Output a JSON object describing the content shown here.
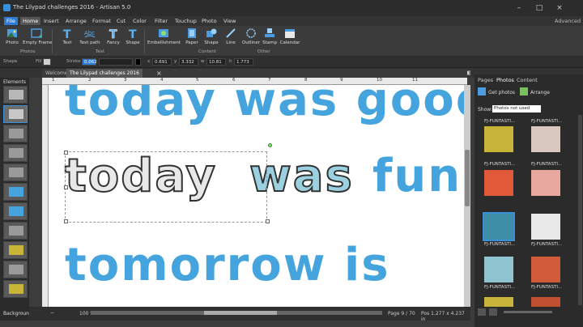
{
  "window": {
    "title": "The Lilypad challenges 2016 - Artisan 5.0",
    "advanced_label": "Advanced",
    "minimize": "–",
    "maximize": "□",
    "close": "×"
  },
  "menu": {
    "items": [
      "File",
      "Home",
      "Insert",
      "Arrange",
      "Format",
      "Cut",
      "Color",
      "Filter",
      "Touchup",
      "Photo",
      "View"
    ]
  },
  "ribbon": {
    "buttons": [
      {
        "label": "Photo",
        "icon": "photo-icon"
      },
      {
        "label": "Empty Frame",
        "icon": "frame-icon"
      },
      {
        "label": "Text",
        "icon": "text-icon"
      },
      {
        "label": "Text path",
        "icon": "text-path-icon"
      },
      {
        "label": "Fancy",
        "icon": "fancy-text-icon"
      },
      {
        "label": "Shape",
        "icon": "shape-text-icon"
      },
      {
        "label": "Embellishment",
        "icon": "embellishment-icon"
      },
      {
        "label": "Paper",
        "icon": "paper-icon"
      },
      {
        "label": "Shape",
        "icon": "shape-icon"
      },
      {
        "label": "Line",
        "icon": "line-icon"
      },
      {
        "label": "Outliner",
        "icon": "outliner-icon"
      },
      {
        "label": "Stamp",
        "icon": "stamp-icon"
      },
      {
        "label": "Calendar",
        "icon": "calendar-icon"
      }
    ],
    "groups": [
      "Photos",
      "Text",
      "Content",
      "Other"
    ]
  },
  "props": {
    "shape_label": "Shape",
    "fill_label": "Fill",
    "stroke_label": "Stroke",
    "stroke_value": "0.062",
    "x_label": "x",
    "x_value": "0.691",
    "y_label": "y",
    "y_value": "3.332",
    "w_label": "w",
    "w_value": "10.81",
    "h_label": "h",
    "h_value": "1.773"
  },
  "tabs": [
    "Welcome",
    "The Lilypad challenges 2016"
  ],
  "elements": {
    "header": "Elements",
    "footer": "Background"
  },
  "ruler_marks": [
    "1",
    "2",
    "3",
    "4",
    "5",
    "6",
    "7",
    "8",
    "9",
    "10",
    "11"
  ],
  "canvas": {
    "line1": "today was good",
    "line2_a": "today",
    "line2_b": "was",
    "line2_c": "fun",
    "line3": "tomorrow is"
  },
  "status": {
    "zoom": "100 %",
    "page": "Page 9 / 70",
    "pos": "Pos 1.277 x 4.237 in"
  },
  "right_panel": {
    "tabs": [
      "Pages",
      "Photos",
      "Content"
    ],
    "get_photos": "Get photos",
    "arrange": "Arrange",
    "show_label": "Show:",
    "show_value": "Photos not used",
    "photo_label": "FJ-FUNTASTI..."
  },
  "colors": {
    "accent": "#3a8fd8",
    "text_blue": "#45a4dd",
    "swatches": [
      "#c9b43a",
      "#d8c8c0",
      "#e05a3a",
      "#e8a8a0",
      "#3e8fa6",
      "#e8e8e8",
      "#8fc4d0",
      "#d05a3a",
      "#c9b43a",
      "#c05030"
    ]
  }
}
